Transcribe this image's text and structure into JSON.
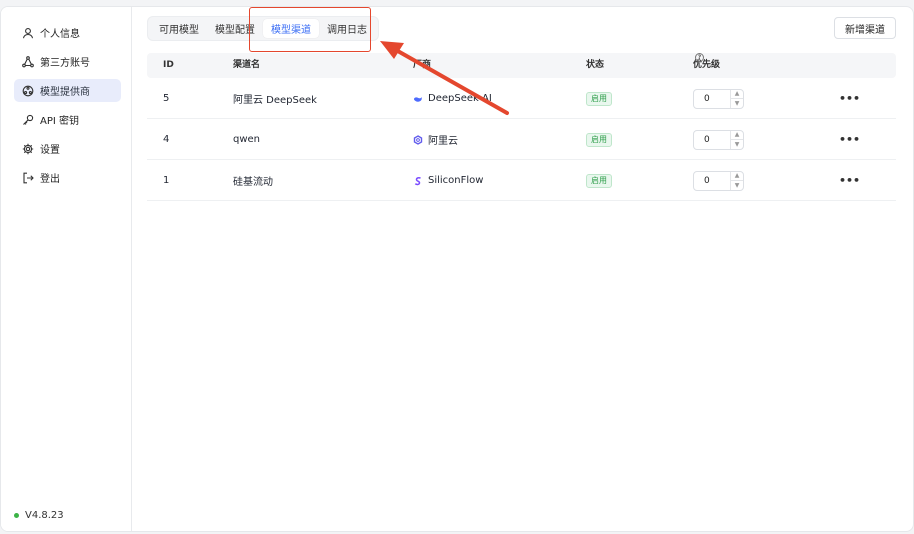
{
  "sidebar": {
    "items": [
      {
        "label": "个人信息",
        "icon": "user-icon"
      },
      {
        "label": "第三方账号",
        "icon": "triangle-nodes-icon"
      },
      {
        "label": "模型提供商",
        "icon": "provider-icon",
        "active": true
      },
      {
        "label": "API 密钥",
        "icon": "key-icon"
      },
      {
        "label": "设置",
        "icon": "gear-icon"
      },
      {
        "label": "登出",
        "icon": "logout-icon"
      }
    ],
    "version": "V4.8.23"
  },
  "tabs": [
    {
      "label": "可用模型"
    },
    {
      "label": "模型配置"
    },
    {
      "label": "模型渠道",
      "active": true
    },
    {
      "label": "调用日志"
    }
  ],
  "new_channel_button": "新增渠道",
  "table": {
    "headers": {
      "id": "ID",
      "name": "渠道名",
      "vendor": "厂商",
      "status": "状态",
      "priority": "优先级"
    },
    "rows": [
      {
        "id": "5",
        "name": "阿里云 DeepSeek",
        "vendor": "DeepSeek AI",
        "vendor_icon": "deepseek-icon",
        "status": "启用",
        "priority": "0"
      },
      {
        "id": "4",
        "name": "qwen",
        "vendor": "阿里云",
        "vendor_icon": "aliyun-icon",
        "status": "启用",
        "priority": "0"
      },
      {
        "id": "1",
        "name": "硅基流动",
        "vendor": "SiliconFlow",
        "vendor_icon": "siliconflow-icon",
        "status": "启用",
        "priority": "0"
      }
    ]
  },
  "colors": {
    "accent": "#3b6ef5",
    "annotation": "#e4472e",
    "status_green": "#2e9e4a"
  }
}
